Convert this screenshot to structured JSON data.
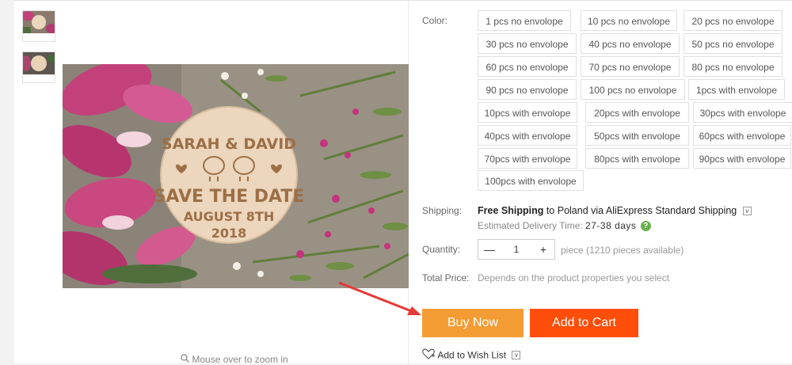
{
  "gallery": {
    "zoom_hint": "Mouse over to zoom in",
    "image_text": {
      "names": "SARAH & DAVID",
      "headline": "SAVE THE DATE",
      "date_line": "AUGUST 8TH",
      "year": "2018"
    }
  },
  "product": {
    "color_label": "Color:",
    "colors": [
      "1 pcs no envolope",
      "10 pcs no envolope",
      "20 pcs no envolope",
      "30 pcs no envolope",
      "40 pcs no envolope",
      "50 pcs no envolope",
      "60 pcs no envolope",
      "70 pcs no envolope",
      "80 pcs no envolope",
      "90 pcs no envolope",
      "100 pcs no envolope",
      "1pcs with envolope",
      "10pcs with envolope",
      "20pcs with envolope",
      "30pcs with envolope",
      "40pcs with envolope",
      "50pcs with envolope",
      "60pcs with envolope",
      "70pcs with envolope",
      "80pcs with envolope",
      "90pcs with envolope",
      "100pcs with envolope"
    ],
    "shipping_label": "Shipping:",
    "shipping": {
      "free": "Free Shipping",
      "to_text": "to Poland via AliExpress Standard Shipping"
    },
    "estimated_label": "Estimated Delivery Time:",
    "estimated_days": "27-38 days",
    "quantity_label": "Quantity:",
    "quantity_value": "1",
    "quantity_note": "piece (1210 pieces available)",
    "total_label": "Total Price:",
    "total_note": "Depends on the product properties you select",
    "buy_now": "Buy Now",
    "add_to_cart": "Add to Cart",
    "wishlist": "Add to Wish List"
  },
  "colors": {
    "buy_now": "#f39c34",
    "add_to_cart": "#ff4e0a",
    "annotation_arrow": "#e53935",
    "help_icon": "#6ab04c"
  }
}
